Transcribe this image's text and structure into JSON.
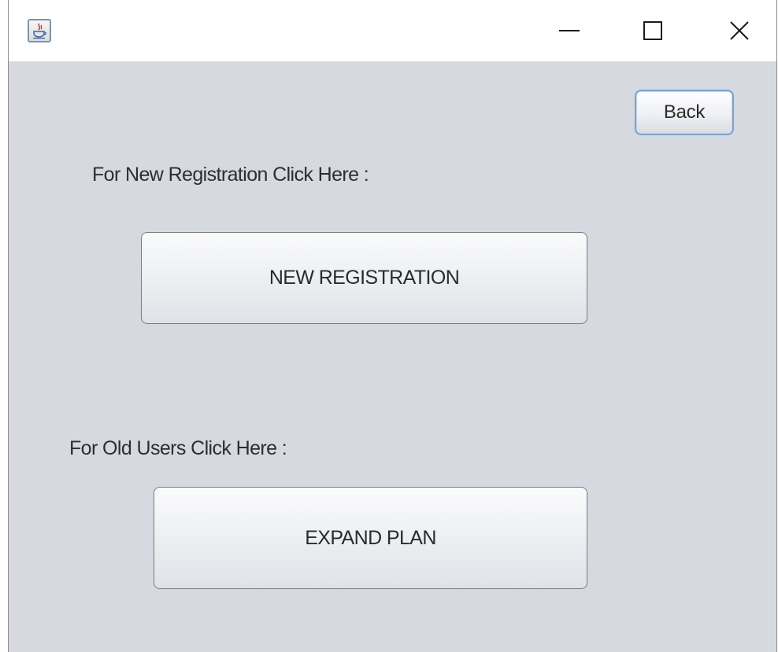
{
  "window": {
    "app_icon": "java-coffee-cup-icon",
    "controls": {
      "minimize_icon": "minimize-icon",
      "maximize_icon": "maximize-icon",
      "close_icon": "close-icon"
    }
  },
  "content": {
    "back_label": "Back",
    "new_registration_prompt": "For New Registration Click Here :",
    "new_registration_button": "NEW REGISTRATION",
    "old_users_prompt": "For Old Users Click Here :",
    "expand_plan_button": "EXPAND PLAN"
  },
  "colors": {
    "client_background": "#d6d9df",
    "focus_border": "#7ca3cf"
  }
}
